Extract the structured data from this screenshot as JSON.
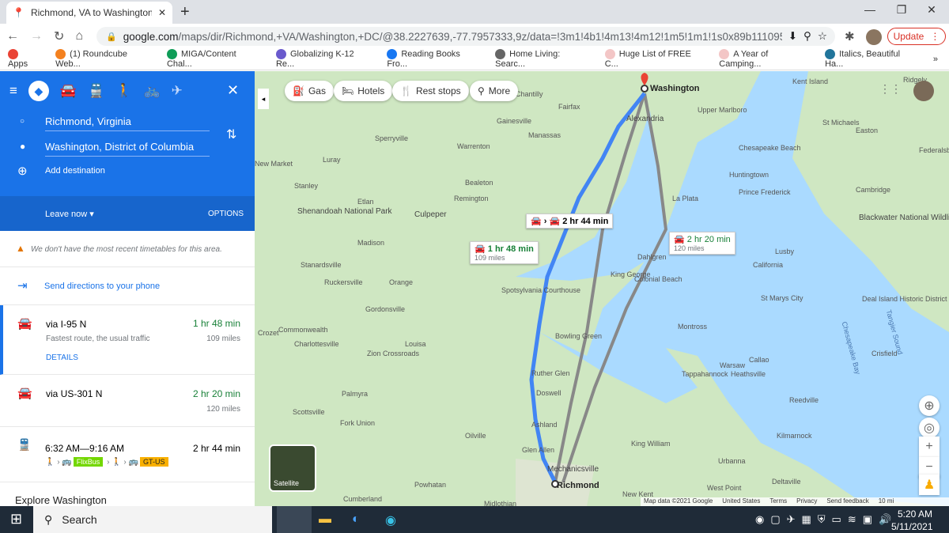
{
  "browser": {
    "tab_title": "Richmond, VA to Washington, DC",
    "url_host": "google.com",
    "url_rest": "/maps/dir/Richmond,+VA/Washington,+DC/@38.2227639,-77.7957333,9z/data=!3m1!4b1!4m13!4m12!1m5!1m1!1s0x89b111095799c9e...",
    "update_label": "Update",
    "bookmarks": [
      "Apps",
      "(1) Roundcube Web...",
      "MIGA/Content Chal...",
      "Globalizing K-12 Re...",
      "Reading Books Fro...",
      "Home Living: Searc...",
      "Huge List of FREE C...",
      "A Year of Camping...",
      "Italics, Beautiful Ha..."
    ],
    "more": "»"
  },
  "sidebar": {
    "origin": "Richmond, Virginia",
    "destination": "Washington, District of Columbia",
    "add_destination": "Add destination",
    "leave_now": "Leave now",
    "options": "OPTIONS",
    "warning": "We don't have the most recent timetables for this area.",
    "send_directions": "Send directions to your phone",
    "routes": [
      {
        "name": "via I-95 N",
        "time": "1 hr 48 min",
        "desc": "Fastest route, the usual traffic",
        "distance": "109 miles",
        "details": "DETAILS"
      },
      {
        "name": "via US-301 N",
        "time": "2 hr 20 min",
        "distance": "120 miles"
      }
    ],
    "transit": {
      "times": "6:32 AM—9:16 AM",
      "duration": "2 hr 44 min",
      "lines": [
        {
          "name": "FlixBus",
          "color": "#73d700"
        },
        {
          "name": "GT-US",
          "color": "#f9b000"
        }
      ]
    },
    "explore": "Explore Washington"
  },
  "map": {
    "chips": [
      "Gas",
      "Hotels",
      "Rest stops",
      "More"
    ],
    "route_boxes": [
      {
        "time": "1 hr 48 min",
        "distance": "109 miles"
      },
      {
        "time": "2 hr 20 min",
        "distance": "120 miles"
      },
      {
        "time": "2 hr 44 min"
      }
    ],
    "places": [
      "Washington",
      "Alexandria",
      "Chantilly",
      "Fairfax",
      "Manassas",
      "Gainesville",
      "Warrenton",
      "Upper Marlboro",
      "Chesapeake Beach",
      "Huntingtown",
      "Prince Frederick",
      "La Plata",
      "Culpeper",
      "Remington",
      "Bealeton",
      "Stanley",
      "Luray",
      "Sperryville",
      "New Market",
      "Etlan",
      "Shenandoah National Park",
      "Madison",
      "Stanardsville",
      "Orange",
      "Ruckersville",
      "Gordonsville",
      "Spotsylvania Courthouse",
      "King George",
      "Colonial Beach",
      "Dahlgren",
      "Bowling Green",
      "Montross",
      "Warsaw",
      "Tappahannock",
      "Louisa",
      "Charlottesville",
      "Zion Crossroads",
      "Ruther Glen",
      "Doswell",
      "Ashland",
      "Palmyra",
      "Scottsville",
      "Fork Union",
      "Oilville",
      "Glen Allen",
      "Mechanicsville",
      "Richmond",
      "King William",
      "Urbanna",
      "Deltaville",
      "West Point",
      "New Kent",
      "Powhatan",
      "Midlothian",
      "Cumberland",
      "Crozet",
      "Heathsville",
      "Reedville",
      "Kilmarnock",
      "St Marys City",
      "Lusby",
      "California",
      "Blackwater National Wildlife Refuge",
      "Cambridge",
      "Easton",
      "St Michaels",
      "Deal Island Historic District",
      "Crisfield",
      "Chesapeake Bay",
      "Tangier Sound",
      "Kent Island",
      "Ridgely",
      "Federalsburg",
      "Callao",
      "Commonwealth"
    ],
    "satellite": "Satellite",
    "footer": [
      "Map data ©2021 Google",
      "United States",
      "Terms",
      "Privacy",
      "Send feedback",
      "10 mi"
    ]
  },
  "taskbar": {
    "search": "Search",
    "time": "5:20 AM",
    "date": "5/11/2021"
  }
}
